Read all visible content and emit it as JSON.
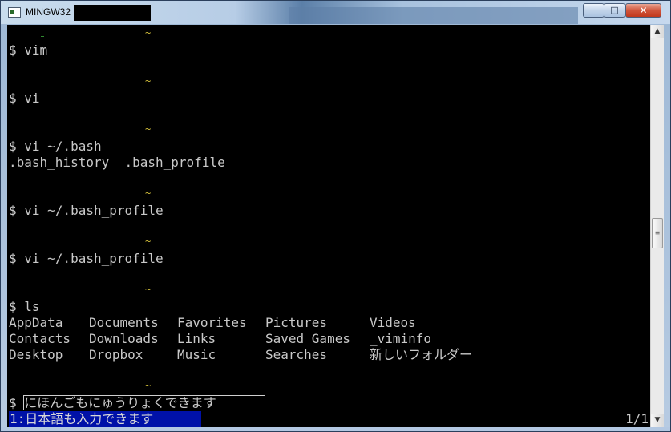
{
  "window": {
    "title": "MINGW32",
    "buttons": {
      "minimize": "−",
      "maximize": "□",
      "close": "✕"
    }
  },
  "terminal": {
    "lines": [
      "$ vim",
      "$ vi",
      "$ vi ~/.bash",
      ".bash_history  .bash_profile",
      "$ vi ~/.bash_profile",
      "$ vi ~/.bash_profile",
      "$ ls"
    ],
    "tilde": "~",
    "ls_output": {
      "col1": [
        "AppData",
        "Contacts",
        "Desktop"
      ],
      "col2": [
        "Documents",
        "Downloads",
        "Dropbox"
      ],
      "col3": [
        "Favorites",
        "Links",
        "Music"
      ],
      "col4": [
        "Pictures",
        "Saved Games",
        "Searches"
      ],
      "col5": [
        "Videos",
        "_viminfo",
        "新しいフォルダー"
      ]
    },
    "prompt_symbol": "$",
    "ime_input": "にほんごもにゅうりょくできます",
    "candidate": "1:日本語も入力できます",
    "page_indicator": "1/1"
  },
  "scrollbar": {
    "up_arrow": "▲",
    "down_arrow": "▼",
    "thumb_grip": "≡"
  }
}
